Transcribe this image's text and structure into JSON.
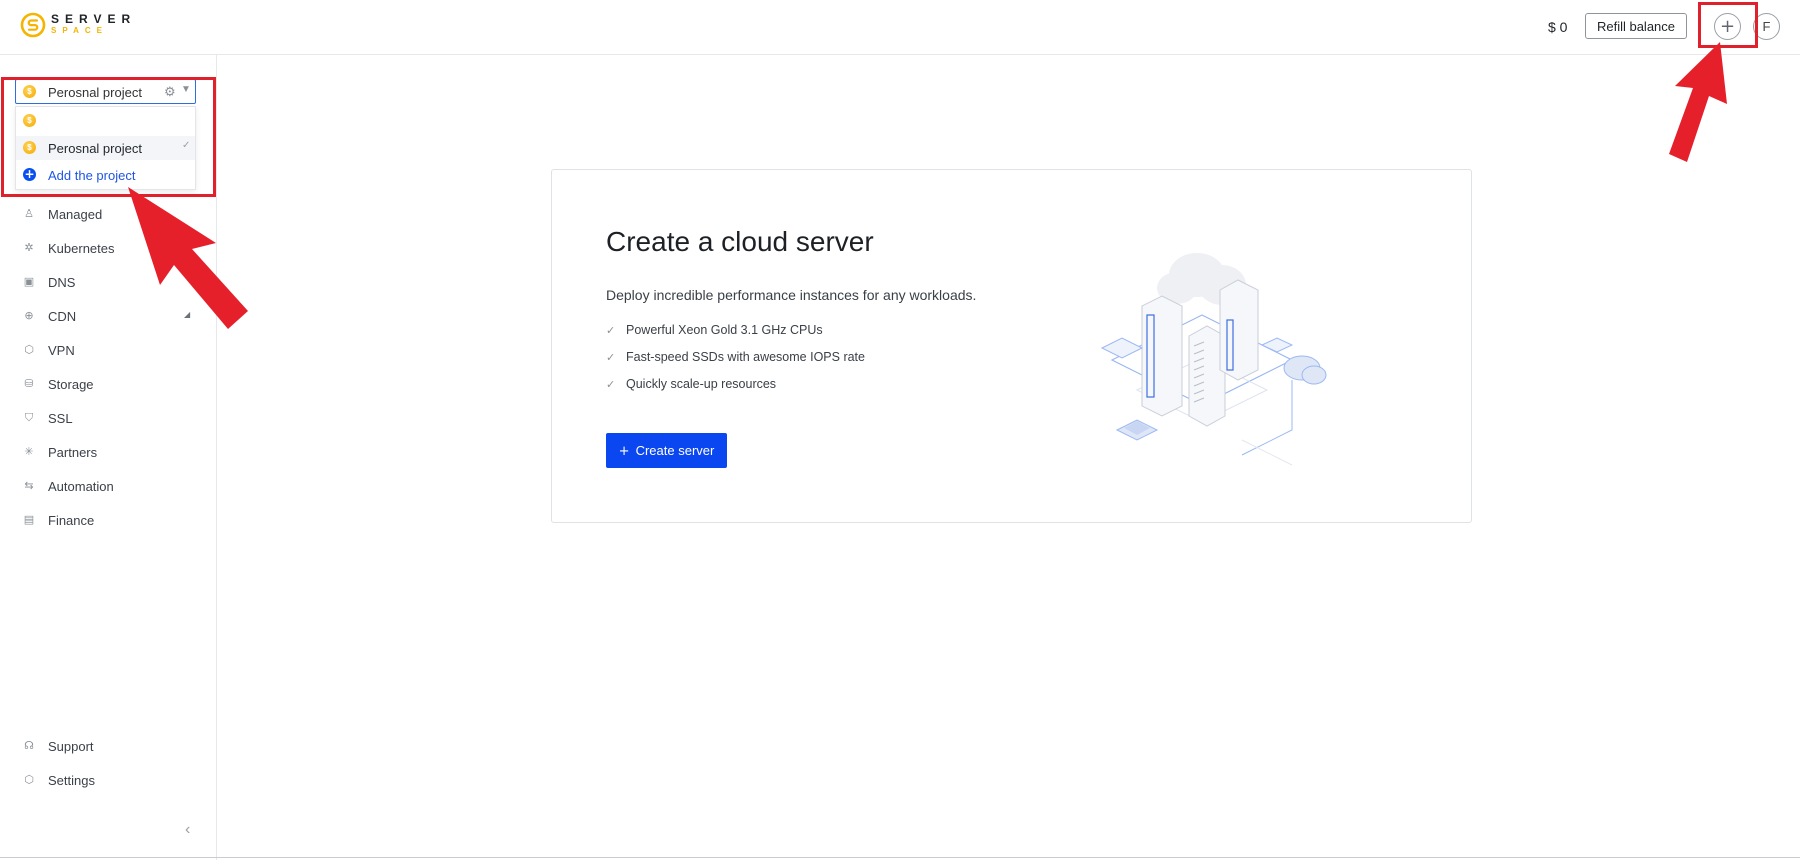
{
  "header": {
    "logo_line1": "SERVER",
    "logo_line2": "SPACE",
    "balance": "$ 0",
    "refill_label": "Refill balance",
    "add_symbol": "+",
    "user_initial": "F"
  },
  "sidebar": {
    "project_selected": "Perosnal project",
    "dropdown": {
      "items": [
        {
          "label": ""
        },
        {
          "label": "Perosnal project",
          "checked": true
        }
      ],
      "add_label": "Add the project"
    },
    "nav": [
      {
        "label": "Managed",
        "icon": "managed-icon"
      },
      {
        "label": "Kubernetes",
        "icon": "kubernetes-icon"
      },
      {
        "label": "DNS",
        "icon": "dns-icon"
      },
      {
        "label": "CDN",
        "icon": "cdn-icon",
        "expandable": true
      },
      {
        "label": "VPN",
        "icon": "vpn-icon"
      },
      {
        "label": "Storage",
        "icon": "storage-icon"
      },
      {
        "label": "SSL",
        "icon": "ssl-icon"
      },
      {
        "label": "Partners",
        "icon": "partners-icon"
      },
      {
        "label": "Automation",
        "icon": "automation-icon"
      },
      {
        "label": "Finance",
        "icon": "finance-icon"
      }
    ],
    "bottom": [
      {
        "label": "Support",
        "icon": "support-icon"
      },
      {
        "label": "Settings",
        "icon": "settings-icon"
      }
    ]
  },
  "main": {
    "title": "Create a cloud server",
    "description": "Deploy incredible performance instances for any workloads.",
    "features": [
      "Powerful Xeon Gold 3.1 GHz CPUs",
      "Fast-speed SSDs with awesome IOPS rate",
      "Quickly scale-up resources"
    ],
    "create_button": "Create server"
  },
  "colors": {
    "accent_blue": "#0a47f0",
    "highlight_red": "#e0202a",
    "coin_yellow": "#f4a900"
  }
}
